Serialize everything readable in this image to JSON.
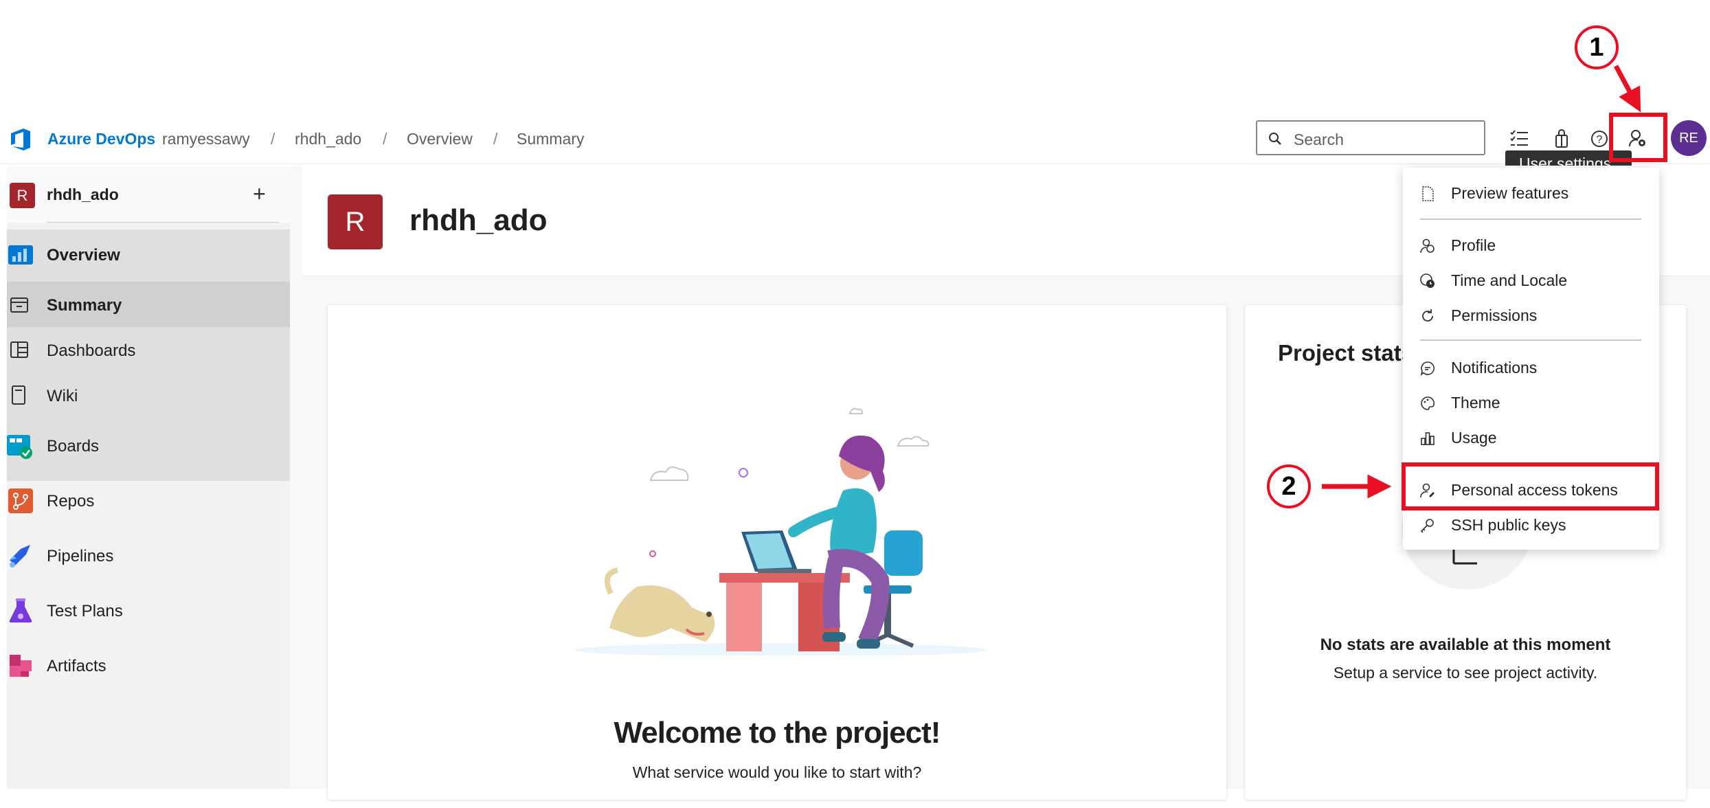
{
  "header": {
    "brand": "Azure DevOps",
    "breadcrumbs": [
      "ramyessawy",
      "rhdh_ado",
      "Overview",
      "Summary"
    ],
    "separator": "/",
    "search_placeholder": "Search",
    "avatar_initials": "RE",
    "tooltip": "User settings",
    "icons": [
      "task-list-icon",
      "shopping-bag-icon",
      "help-icon",
      "user-settings-icon"
    ]
  },
  "sidebar": {
    "project_initial": "R",
    "project_name": "rhdh_ado",
    "add_label": "+",
    "items": [
      {
        "label": "Overview",
        "icon": "overview-icon"
      },
      {
        "label": "Summary",
        "icon": "summary-icon"
      },
      {
        "label": "Dashboards",
        "icon": "dashboards-icon"
      },
      {
        "label": "Wiki",
        "icon": "wiki-icon"
      },
      {
        "label": "Boards",
        "icon": "boards-icon"
      },
      {
        "label": "Repos",
        "icon": "repos-icon"
      },
      {
        "label": "Pipelines",
        "icon": "pipelines-icon"
      },
      {
        "label": "Test Plans",
        "icon": "test-plans-icon"
      },
      {
        "label": "Artifacts",
        "icon": "artifacts-icon"
      }
    ],
    "selected": "Summary"
  },
  "main": {
    "project_initial": "R",
    "project_title": "rhdh_ado",
    "welcome_title": "Welcome to the project!",
    "welcome_subtitle": "What service would you like to start with?",
    "stats_title": "Project stats",
    "stats_empty": "No stats are available at this moment",
    "stats_hint": "Setup a service to see project activity."
  },
  "menu": {
    "items": [
      {
        "label": "Preview features",
        "icon": "document-icon"
      },
      {
        "label": "Profile",
        "icon": "profile-icon"
      },
      {
        "label": "Time and Locale",
        "icon": "globe-clock-icon"
      },
      {
        "label": "Permissions",
        "icon": "refresh-icon"
      },
      {
        "label": "Notifications",
        "icon": "chat-icon"
      },
      {
        "label": "Theme",
        "icon": "palette-icon"
      },
      {
        "label": "Usage",
        "icon": "bar-chart-icon"
      },
      {
        "label": "Personal access tokens",
        "icon": "user-key-icon"
      },
      {
        "label": "SSH public keys",
        "icon": "key-icon"
      }
    ]
  },
  "annotations": {
    "step1": "1",
    "step2": "2",
    "color": "#e81123"
  },
  "colors": {
    "brand_blue": "#0078d4",
    "project_red": "#a4262c",
    "avatar_purple": "#5c2e91"
  }
}
